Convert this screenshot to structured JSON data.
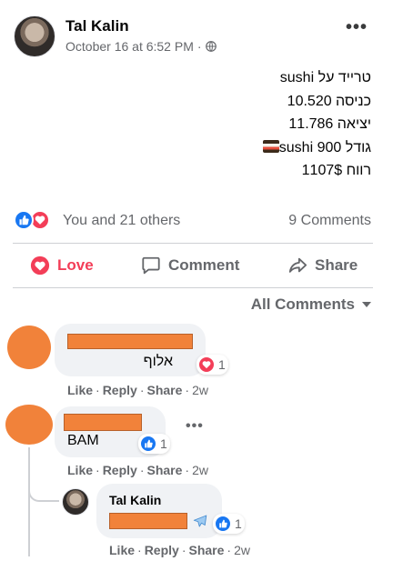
{
  "post": {
    "author": "Tal Kalin",
    "timestamp": "October 16 at 6:52 PM",
    "separator": "·",
    "body_lines": [
      "טרייד על sushi",
      "כניסה 10.520",
      "יציאה 11.786",
      "גודל 900 sushi",
      "רווח 1107$"
    ],
    "reactions_text": "You and 21 others",
    "comments_count": "9 Comments"
  },
  "actions": {
    "love": "Love",
    "comment": "Comment",
    "share": "Share"
  },
  "comments_filter": "All Comments",
  "comments": [
    {
      "text": "אלוף",
      "reaction_count": "1",
      "like": "Like",
      "reply": "Reply",
      "share": "Share",
      "age": "2w"
    },
    {
      "text": "BAM",
      "reaction_count": "1",
      "like": "Like",
      "reply": "Reply",
      "share": "Share",
      "age": "2w"
    }
  ],
  "reply": {
    "author": "Tal Kalin",
    "reaction_count": "1",
    "like": "Like",
    "reply": "Reply",
    "share": "Share",
    "age": "2w"
  },
  "dot": "·",
  "icons": [
    "globe-icon",
    "more-options-icon",
    "like-reaction-icon",
    "love-reaction-icon",
    "heart-icon",
    "comment-icon",
    "share-arrow-icon",
    "caret-down-icon",
    "airplane-icon"
  ],
  "colors": {
    "like_blue": "#1877f2",
    "love_red": "#f33e58",
    "secondary_text": "#65676b",
    "redaction_orange": "#f1823a",
    "bubble_gray": "#f0f2f5"
  }
}
